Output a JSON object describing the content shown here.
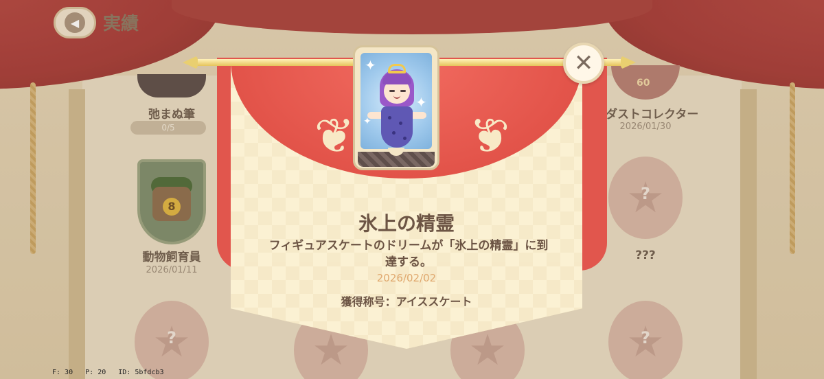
{
  "header": {
    "title": "実績",
    "back_icon": "chevron-left-icon"
  },
  "background": {
    "items": [
      {
        "label": "弛まぬ筆",
        "progress": "0/5",
        "progress_fraction": 0.0
      },
      {
        "label": "ターダストコレクター",
        "date": "2026/01/30",
        "badge_number": "60"
      },
      {
        "label": "動物飼育員",
        "date": "2026/01/11",
        "badge_number": "8"
      },
      {
        "label": "???",
        "locked": true
      }
    ],
    "locked_symbol": "?"
  },
  "modal": {
    "title": "氷上の精霊",
    "description": "フィギュアスケートのドリーム が「氷上の精霊」に到達する。",
    "description_line1": "フィギュアスケートのドリームが「氷上の精霊」に到",
    "description_line2": "達する。",
    "date": "2026/02/02",
    "reward": "獲得称号：アイススケート",
    "close_icon": "close-icon",
    "colors": {
      "drape": "#e25349",
      "banner": "#fbf1d3",
      "text": "#6c5444",
      "date": "#e0a86e"
    }
  },
  "debug": {
    "f": "F: 30",
    "p": "P: 20",
    "id": "ID: 5bfdcb3"
  }
}
